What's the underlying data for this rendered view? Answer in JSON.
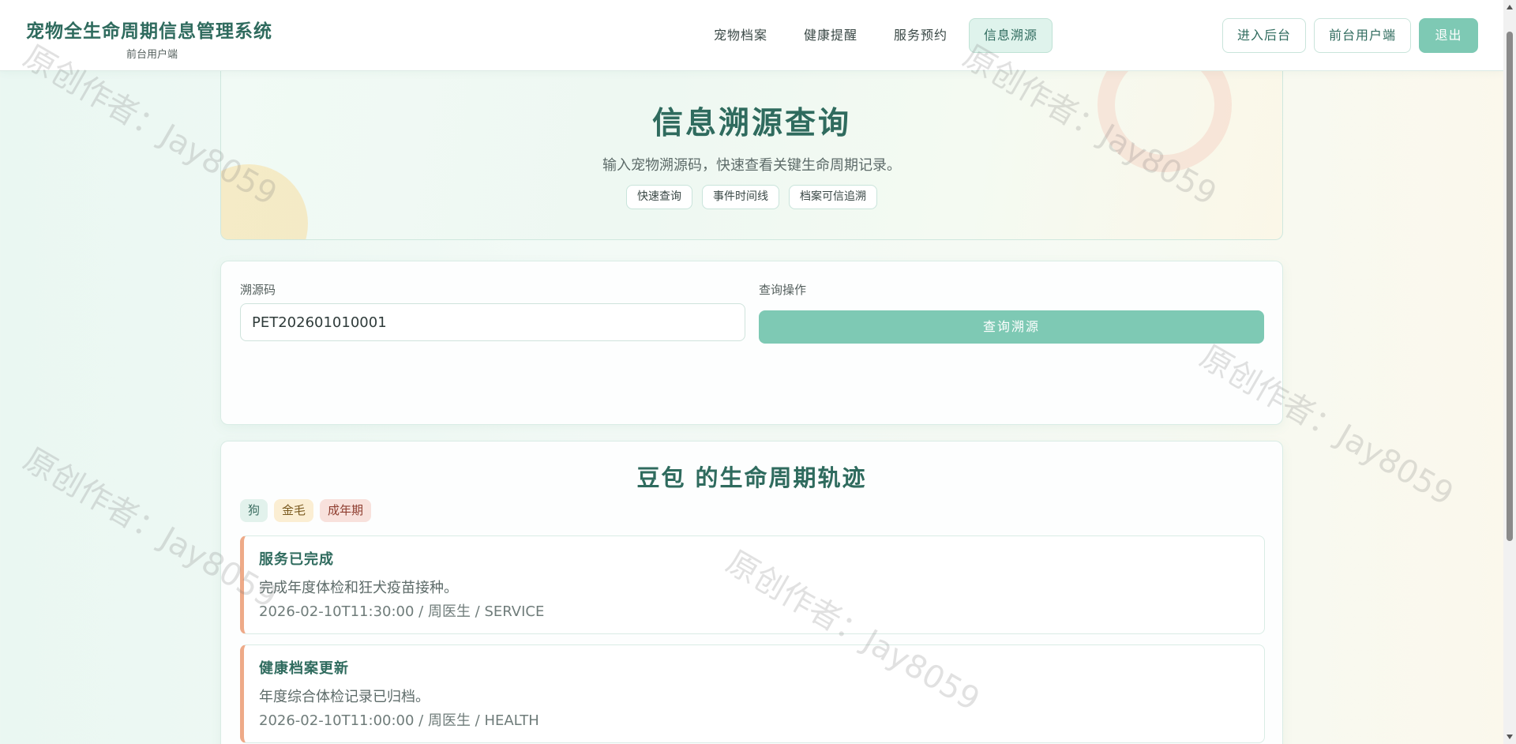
{
  "header": {
    "title": "宠物全生命周期信息管理系统",
    "subtitle": "前台用户端",
    "nav": [
      {
        "label": "宠物档案"
      },
      {
        "label": "健康提醒"
      },
      {
        "label": "服务预约"
      },
      {
        "label": "信息溯源",
        "active": true
      }
    ],
    "actions": {
      "admin": "进入后台",
      "front": "前台用户端",
      "logout": "退出"
    }
  },
  "hero": {
    "title": "信息溯源查询",
    "subtitle": "输入宠物溯源码，快速查看关键生命周期记录。",
    "chips": [
      "快速查询",
      "事件时间线",
      "档案可信追溯"
    ]
  },
  "query": {
    "code_label": "溯源码",
    "code_value": "PET202601010001",
    "action_label": "查询操作",
    "button": "查询溯源"
  },
  "timeline": {
    "title": "豆包 的生命周期轨迹",
    "tags": [
      "狗",
      "金毛",
      "成年期"
    ],
    "events": [
      {
        "title": "服务已完成",
        "desc": "完成年度体检和狂犬疫苗接种。",
        "meta": "2026-02-10T11:30:00 / 周医生 / SERVICE"
      },
      {
        "title": "健康档案更新",
        "desc": "年度综合体检记录已归档。",
        "meta": "2026-02-10T11:00:00 / 周医生 / HEALTH"
      }
    ]
  },
  "watermark": "原创作者：Jay8059",
  "colors": {
    "accent": "#7ec9b4",
    "brand_text": "#2f6b5e",
    "event_border": "#eeaa88"
  }
}
